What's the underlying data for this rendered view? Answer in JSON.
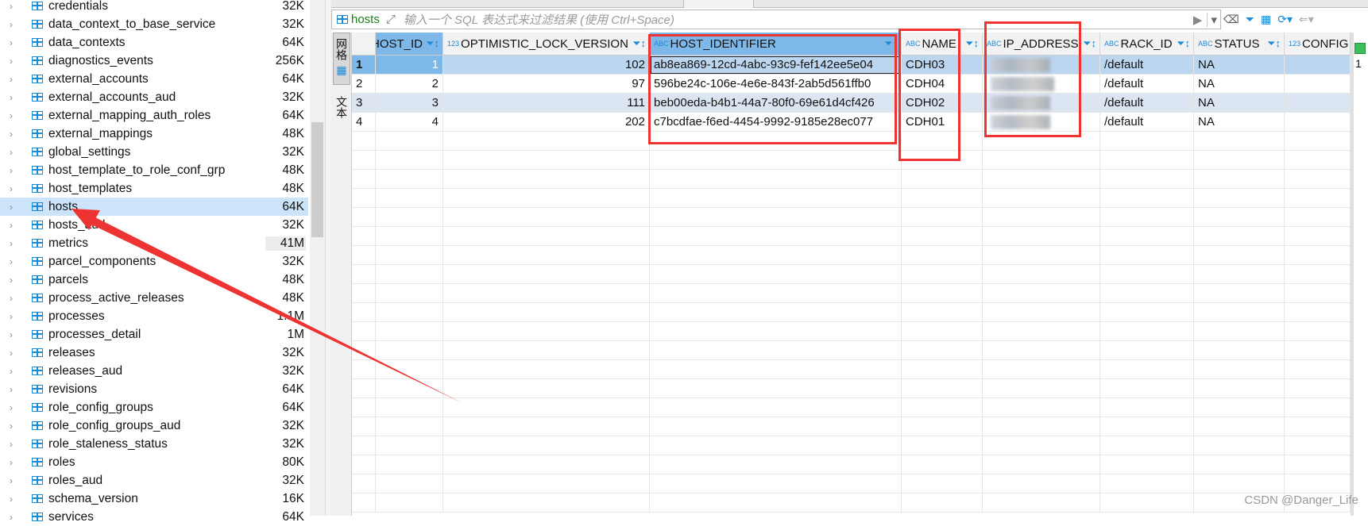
{
  "sidebar": {
    "items": [
      {
        "name": "credentials",
        "size": "32K"
      },
      {
        "name": "data_context_to_base_service",
        "size": "32K"
      },
      {
        "name": "data_contexts",
        "size": "64K"
      },
      {
        "name": "diagnostics_events",
        "size": "256K"
      },
      {
        "name": "external_accounts",
        "size": "64K"
      },
      {
        "name": "external_accounts_aud",
        "size": "32K"
      },
      {
        "name": "external_mapping_auth_roles",
        "size": "64K"
      },
      {
        "name": "external_mappings",
        "size": "48K"
      },
      {
        "name": "global_settings",
        "size": "32K"
      },
      {
        "name": "host_template_to_role_conf_grp",
        "size": "48K"
      },
      {
        "name": "host_templates",
        "size": "48K"
      },
      {
        "name": "hosts",
        "size": "64K",
        "selected": true
      },
      {
        "name": "hosts_aud",
        "size": "32K"
      },
      {
        "name": "metrics",
        "size": "41M"
      },
      {
        "name": "parcel_components",
        "size": "32K"
      },
      {
        "name": "parcels",
        "size": "48K"
      },
      {
        "name": "process_active_releases",
        "size": "48K"
      },
      {
        "name": "processes",
        "size": "1.1M"
      },
      {
        "name": "processes_detail",
        "size": "1M"
      },
      {
        "name": "releases",
        "size": "32K"
      },
      {
        "name": "releases_aud",
        "size": "32K"
      },
      {
        "name": "revisions",
        "size": "64K"
      },
      {
        "name": "role_config_groups",
        "size": "64K"
      },
      {
        "name": "role_config_groups_aud",
        "size": "32K"
      },
      {
        "name": "role_staleness_status",
        "size": "32K"
      },
      {
        "name": "roles",
        "size": "80K"
      },
      {
        "name": "roles_aud",
        "size": "32K"
      },
      {
        "name": "schema_version",
        "size": "16K"
      },
      {
        "name": "services",
        "size": "64K"
      }
    ]
  },
  "filter": {
    "table": "hosts",
    "placeholder": "输入一个 SQL 表达式来过滤结果 (使用 Ctrl+Space)"
  },
  "vtabs": {
    "grid": "网格",
    "text": "文本"
  },
  "grid": {
    "columns": [
      {
        "label": "HOST_ID",
        "type": ""
      },
      {
        "label": "OPTIMISTIC_LOCK_VERSION",
        "type": "123"
      },
      {
        "label": "HOST_IDENTIFIER",
        "type": "ABC"
      },
      {
        "label": "NAME",
        "type": "ABC"
      },
      {
        "label": "IP_ADDRESS",
        "type": "ABC"
      },
      {
        "label": "RACK_ID",
        "type": "ABC"
      },
      {
        "label": "STATUS",
        "type": "ABC"
      },
      {
        "label": "CONFIG",
        "type": "123"
      }
    ],
    "rows": [
      {
        "num": "1",
        "host_id": "1",
        "lock": "102",
        "ident": "ab8ea869-12cd-4abc-93c9-fef142ee5e04",
        "name": "CDH03",
        "ip": "",
        "rack": "/default",
        "status": "NA",
        "config": ""
      },
      {
        "num": "2",
        "host_id": "2",
        "lock": "97",
        "ident": "596be24c-106e-4e6e-843f-2ab5d561ffb0",
        "name": "CDH04",
        "ip": "",
        "rack": "/default",
        "status": "NA",
        "config": ""
      },
      {
        "num": "3",
        "host_id": "3",
        "lock": "111",
        "ident": "beb00eda-b4b1-44a7-80f0-69e61d4cf426",
        "name": "CDH02",
        "ip": "",
        "rack": "/default",
        "status": "NA",
        "config": ""
      },
      {
        "num": "4",
        "host_id": "4",
        "lock": "202",
        "ident": "c7bcdfae-f6ed-4454-9992-9185e28ec077",
        "name": "CDH01",
        "ip": "",
        "rack": "/default",
        "status": "NA",
        "config": ""
      }
    ]
  },
  "rightstrip": {
    "count": "1"
  },
  "watermark": "CSDN @Danger_Life",
  "colors": {
    "selection": "#cce4fa",
    "annotation": "#ee3333",
    "accent": "#1a8ad6"
  }
}
